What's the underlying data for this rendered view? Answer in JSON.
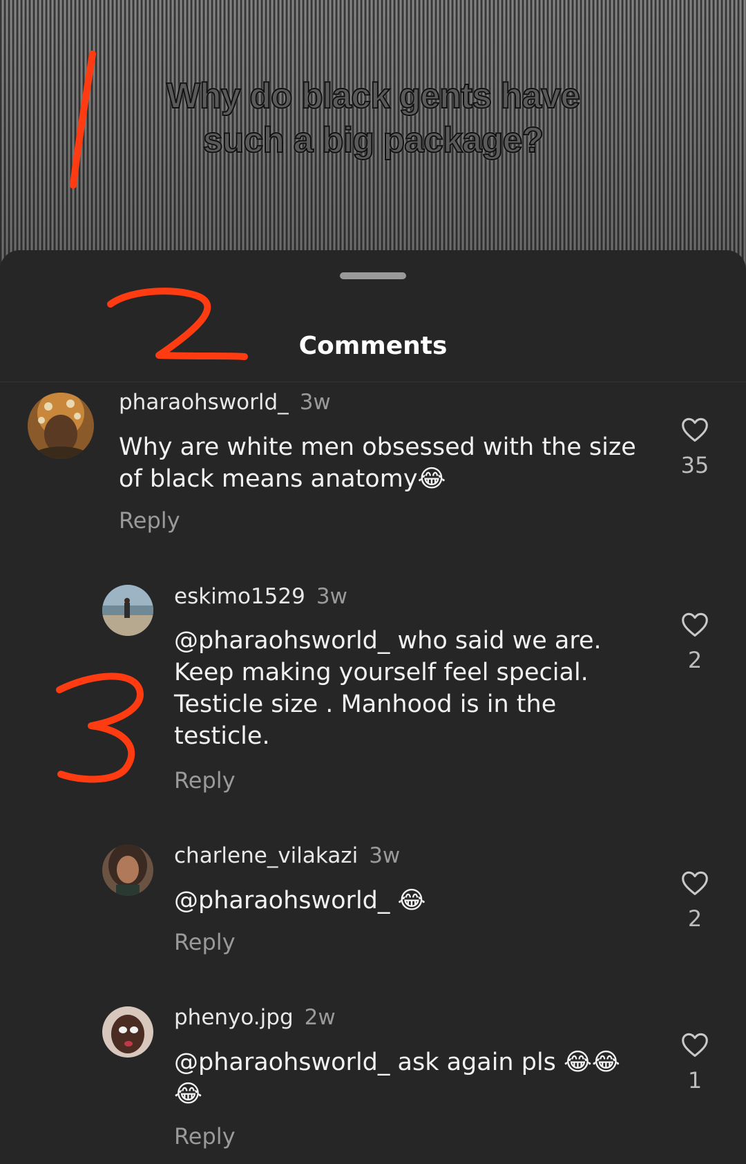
{
  "video": {
    "caption_line1": "Why do black gents have",
    "caption_line2": "such a big package?"
  },
  "sheet": {
    "title": "Comments"
  },
  "annotations": [
    "1",
    "2",
    "3"
  ],
  "comments": [
    {
      "username": "pharaohsworld_",
      "time": "3w",
      "text": "Why are white men obsessed with the size of black means anatomy😂",
      "reply_label": "Reply",
      "likes": "35"
    },
    {
      "username": "eskimo1529",
      "time": "3w",
      "text": "@pharaohsworld_ who said we are. Keep making yourself feel special. Testicle size . Manhood is in the testicle.",
      "reply_label": "Reply",
      "likes": "2"
    },
    {
      "username": "charlene_vilakazi",
      "time": "3w",
      "text": "@pharaohsworld_ 😂",
      "reply_label": "Reply",
      "likes": "2"
    },
    {
      "username": "phenyo.jpg",
      "time": "2w",
      "text": "@pharaohsworld_ ask again pls 😂😂😂",
      "reply_label": "Reply",
      "likes": "1"
    }
  ],
  "colors": {
    "sheet_bg": "#262626",
    "annotation": "#ff3b12",
    "secondary_text": "#9a9a9a"
  }
}
